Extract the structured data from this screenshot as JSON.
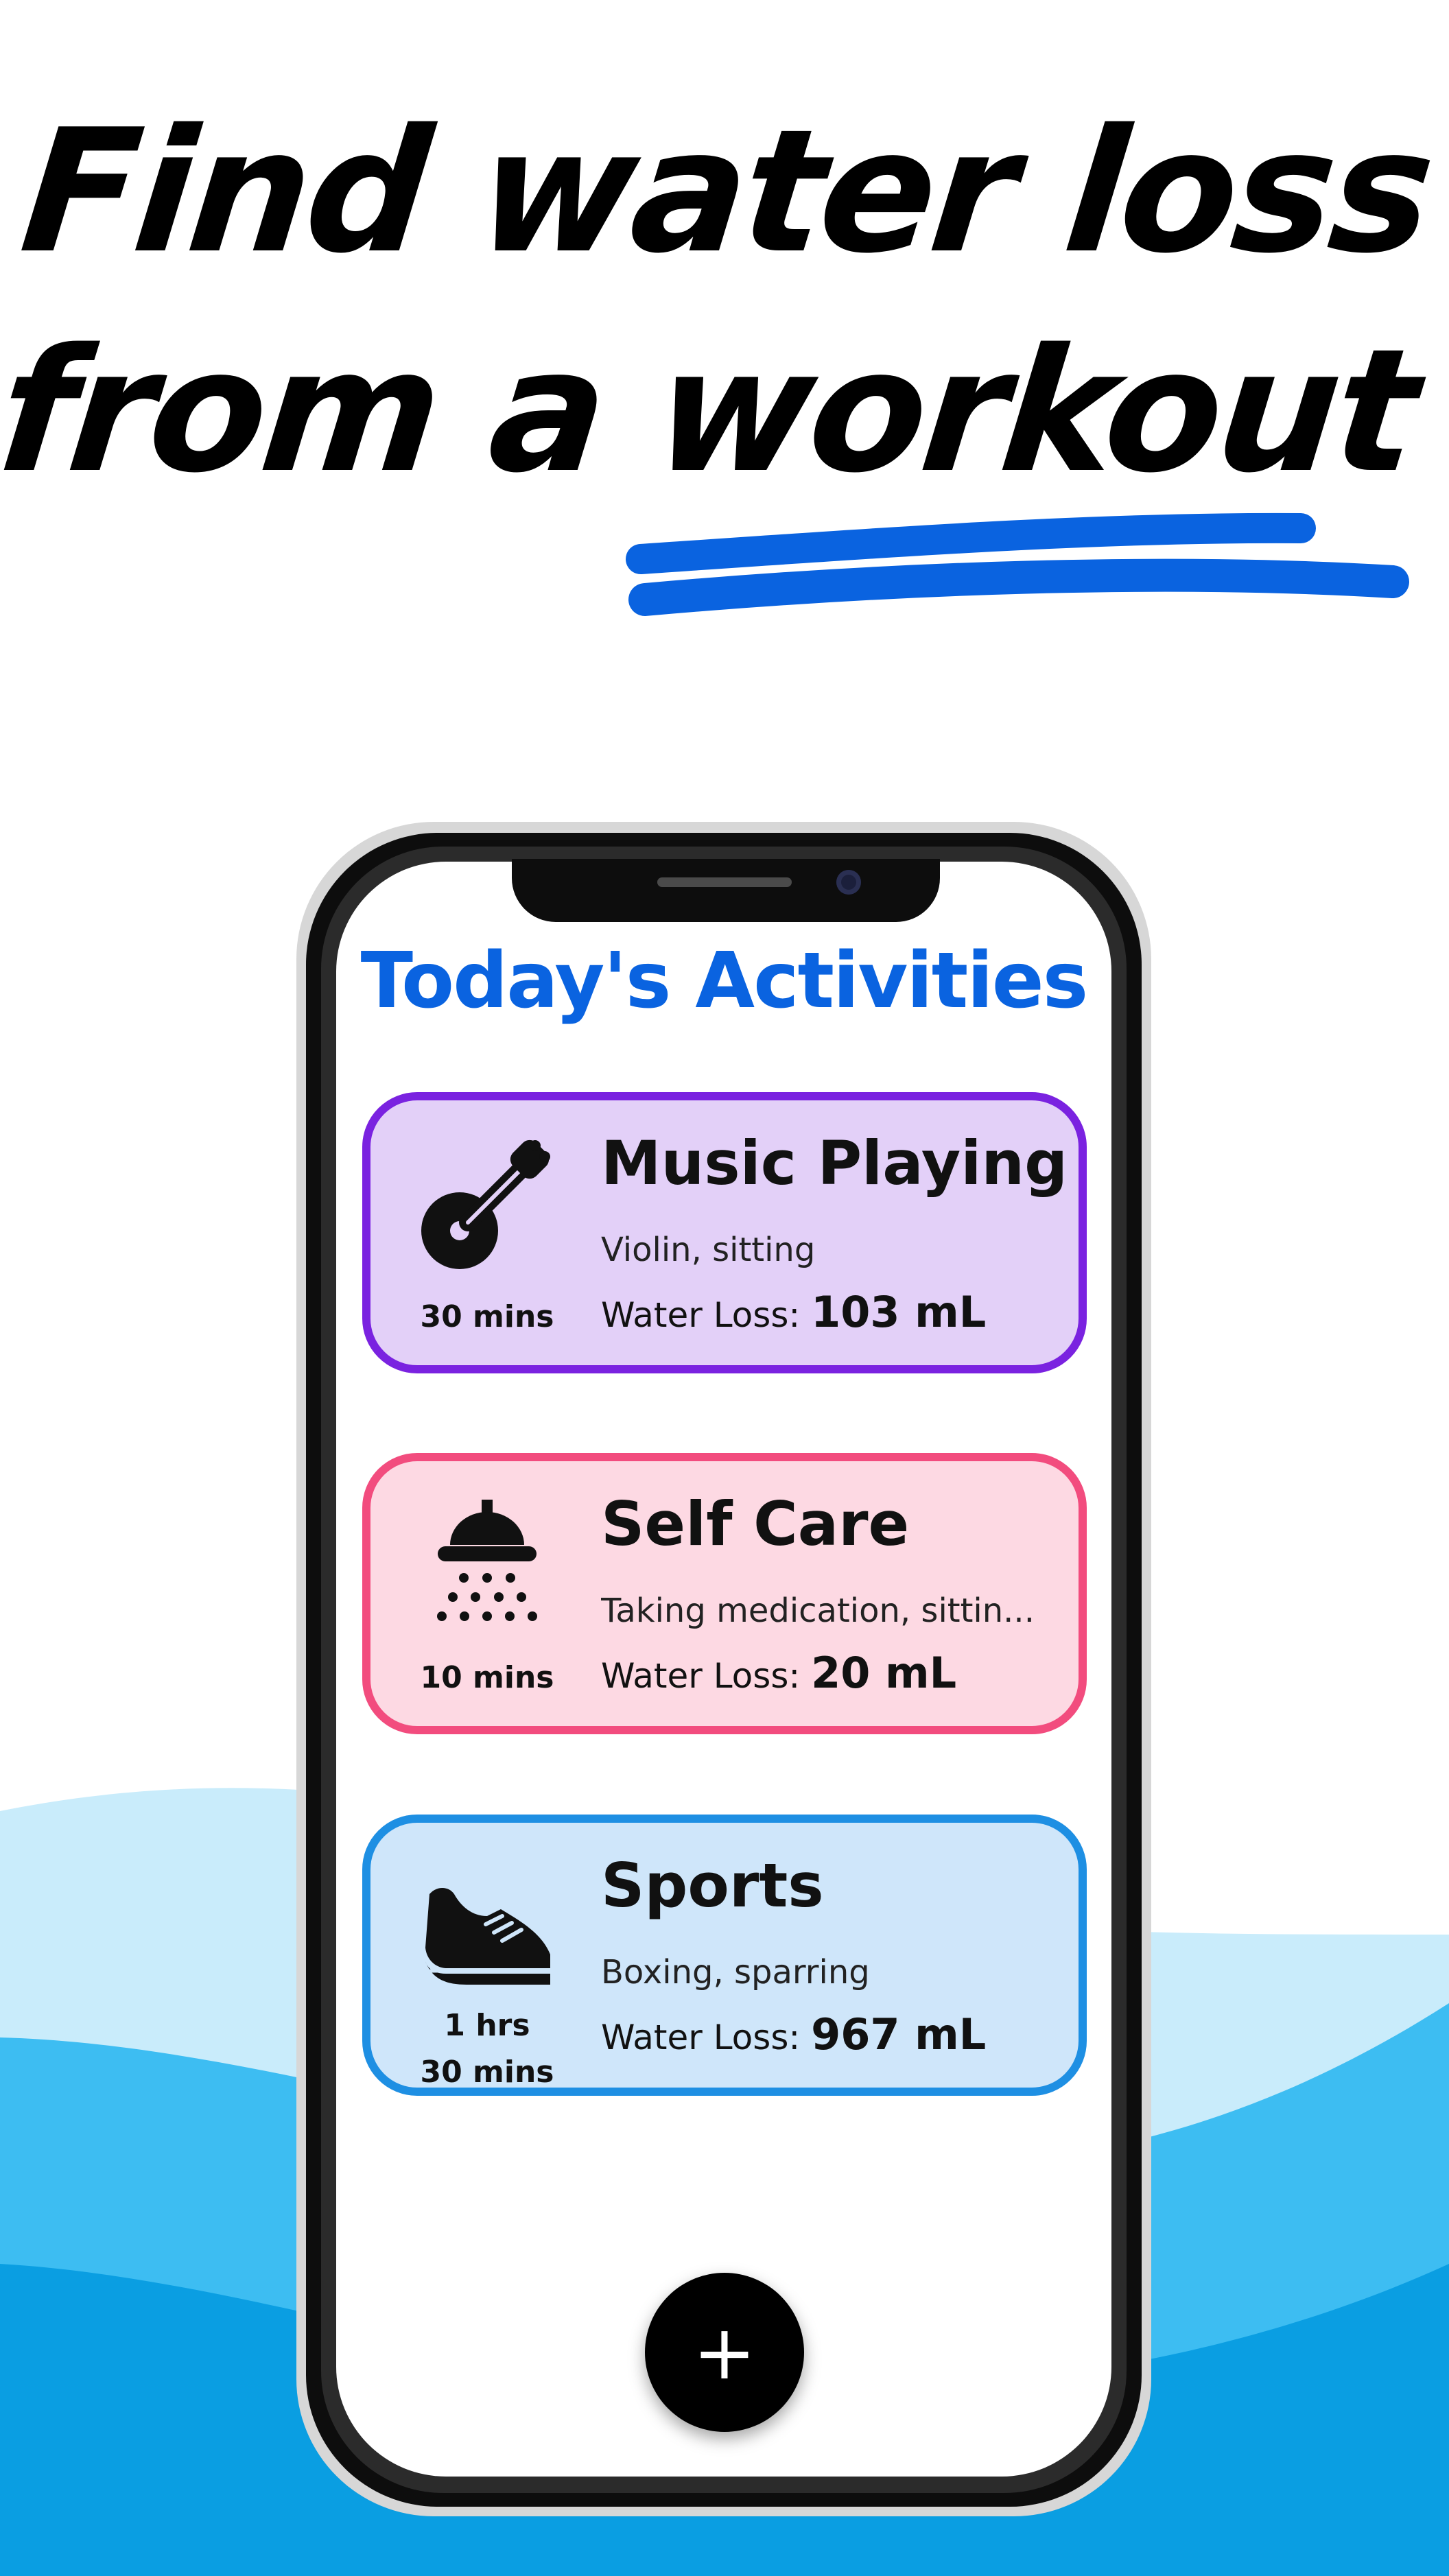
{
  "headline": {
    "line1": "Find water loss",
    "line2": "from a workout"
  },
  "screen": {
    "title": "Today's Activities"
  },
  "activities": [
    {
      "name": "Music Playing",
      "description": "Violin, sitting",
      "duration": "30 mins",
      "water_loss_label": "Water Loss:",
      "water_loss_value": "103 mL",
      "icon": "violin-icon",
      "bg_color": "#e3d0f8",
      "border_color": "#7a22e0"
    },
    {
      "name": "Self Care",
      "description": "Taking medication, sittin...",
      "duration": "10 mins",
      "water_loss_label": "Water Loss:",
      "water_loss_value": "20 mL",
      "icon": "shower-icon",
      "bg_color": "#fdd9e3",
      "border_color": "#f24c7e"
    },
    {
      "name": "Sports",
      "description": "Boxing, sparring",
      "duration_line1": "1 hrs",
      "duration_line2": "30 mins",
      "water_loss_label": "Water Loss:",
      "water_loss_value": "967 mL",
      "icon": "sneaker-icon",
      "bg_color": "#cfe6fa",
      "border_color": "#1e8fe3"
    }
  ],
  "fab": {
    "label": "+",
    "icon": "plus-icon"
  },
  "colors": {
    "accent_blue": "#0a63e0",
    "wave_light": "#c9ecfb",
    "wave_mid": "#3dbdf2",
    "wave_dark": "#0a9ee2"
  }
}
